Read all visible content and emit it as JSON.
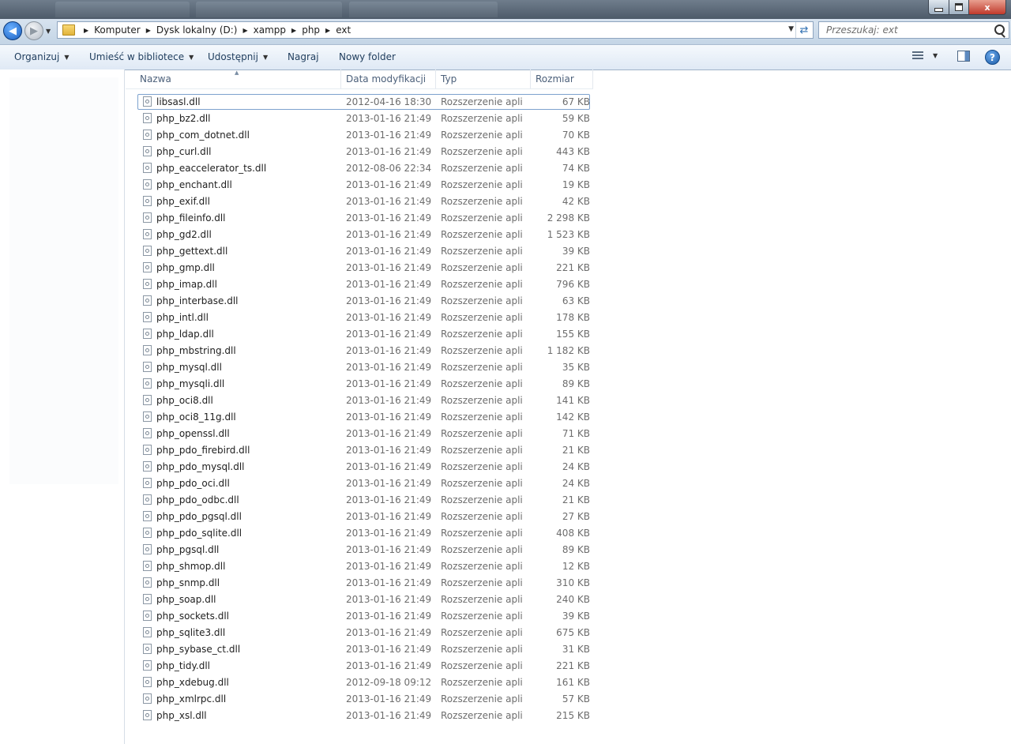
{
  "window": {
    "controls": {
      "minimize": "",
      "maximize": "",
      "close": "x"
    }
  },
  "address": {
    "breadcrumbs": [
      "Komputer",
      "Dysk lokalny (D:)",
      "xampp",
      "php",
      "ext"
    ],
    "search_placeholder": "Przeszukaj: ext"
  },
  "toolbar": {
    "organize": "Organizuj",
    "include_in_library": "Umieść w bibliotece",
    "share": "Udostępnij",
    "burn": "Nagraj",
    "new_folder": "Nowy folder"
  },
  "columns": {
    "name": "Nazwa",
    "date": "Data modyfikacji",
    "type": "Typ",
    "size": "Rozmiar"
  },
  "files": [
    {
      "name": "libsasl.dll",
      "date": "2012-04-16 18:30",
      "type": "Rozszerzenie aplik...",
      "size": "67 KB"
    },
    {
      "name": "php_bz2.dll",
      "date": "2013-01-16 21:49",
      "type": "Rozszerzenie aplik...",
      "size": "59 KB"
    },
    {
      "name": "php_com_dotnet.dll",
      "date": "2013-01-16 21:49",
      "type": "Rozszerzenie aplik...",
      "size": "70 KB"
    },
    {
      "name": "php_curl.dll",
      "date": "2013-01-16 21:49",
      "type": "Rozszerzenie aplik...",
      "size": "443 KB"
    },
    {
      "name": "php_eaccelerator_ts.dll",
      "date": "2012-08-06 22:34",
      "type": "Rozszerzenie aplik...",
      "size": "74 KB"
    },
    {
      "name": "php_enchant.dll",
      "date": "2013-01-16 21:49",
      "type": "Rozszerzenie aplik...",
      "size": "19 KB"
    },
    {
      "name": "php_exif.dll",
      "date": "2013-01-16 21:49",
      "type": "Rozszerzenie aplik...",
      "size": "42 KB"
    },
    {
      "name": "php_fileinfo.dll",
      "date": "2013-01-16 21:49",
      "type": "Rozszerzenie aplik...",
      "size": "2 298 KB"
    },
    {
      "name": "php_gd2.dll",
      "date": "2013-01-16 21:49",
      "type": "Rozszerzenie aplik...",
      "size": "1 523 KB"
    },
    {
      "name": "php_gettext.dll",
      "date": "2013-01-16 21:49",
      "type": "Rozszerzenie aplik...",
      "size": "39 KB"
    },
    {
      "name": "php_gmp.dll",
      "date": "2013-01-16 21:49",
      "type": "Rozszerzenie aplik...",
      "size": "221 KB"
    },
    {
      "name": "php_imap.dll",
      "date": "2013-01-16 21:49",
      "type": "Rozszerzenie aplik...",
      "size": "796 KB"
    },
    {
      "name": "php_interbase.dll",
      "date": "2013-01-16 21:49",
      "type": "Rozszerzenie aplik...",
      "size": "63 KB"
    },
    {
      "name": "php_intl.dll",
      "date": "2013-01-16 21:49",
      "type": "Rozszerzenie aplik...",
      "size": "178 KB"
    },
    {
      "name": "php_ldap.dll",
      "date": "2013-01-16 21:49",
      "type": "Rozszerzenie aplik...",
      "size": "155 KB"
    },
    {
      "name": "php_mbstring.dll",
      "date": "2013-01-16 21:49",
      "type": "Rozszerzenie aplik...",
      "size": "1 182 KB"
    },
    {
      "name": "php_mysql.dll",
      "date": "2013-01-16 21:49",
      "type": "Rozszerzenie aplik...",
      "size": "35 KB"
    },
    {
      "name": "php_mysqli.dll",
      "date": "2013-01-16 21:49",
      "type": "Rozszerzenie aplik...",
      "size": "89 KB"
    },
    {
      "name": "php_oci8.dll",
      "date": "2013-01-16 21:49",
      "type": "Rozszerzenie aplik...",
      "size": "141 KB"
    },
    {
      "name": "php_oci8_11g.dll",
      "date": "2013-01-16 21:49",
      "type": "Rozszerzenie aplik...",
      "size": "142 KB"
    },
    {
      "name": "php_openssl.dll",
      "date": "2013-01-16 21:49",
      "type": "Rozszerzenie aplik...",
      "size": "71 KB"
    },
    {
      "name": "php_pdo_firebird.dll",
      "date": "2013-01-16 21:49",
      "type": "Rozszerzenie aplik...",
      "size": "21 KB"
    },
    {
      "name": "php_pdo_mysql.dll",
      "date": "2013-01-16 21:49",
      "type": "Rozszerzenie aplik...",
      "size": "24 KB"
    },
    {
      "name": "php_pdo_oci.dll",
      "date": "2013-01-16 21:49",
      "type": "Rozszerzenie aplik...",
      "size": "24 KB"
    },
    {
      "name": "php_pdo_odbc.dll",
      "date": "2013-01-16 21:49",
      "type": "Rozszerzenie aplik...",
      "size": "21 KB"
    },
    {
      "name": "php_pdo_pgsql.dll",
      "date": "2013-01-16 21:49",
      "type": "Rozszerzenie aplik...",
      "size": "27 KB"
    },
    {
      "name": "php_pdo_sqlite.dll",
      "date": "2013-01-16 21:49",
      "type": "Rozszerzenie aplik...",
      "size": "408 KB"
    },
    {
      "name": "php_pgsql.dll",
      "date": "2013-01-16 21:49",
      "type": "Rozszerzenie aplik...",
      "size": "89 KB"
    },
    {
      "name": "php_shmop.dll",
      "date": "2013-01-16 21:49",
      "type": "Rozszerzenie aplik...",
      "size": "12 KB"
    },
    {
      "name": "php_snmp.dll",
      "date": "2013-01-16 21:49",
      "type": "Rozszerzenie aplik...",
      "size": "310 KB"
    },
    {
      "name": "php_soap.dll",
      "date": "2013-01-16 21:49",
      "type": "Rozszerzenie aplik...",
      "size": "240 KB"
    },
    {
      "name": "php_sockets.dll",
      "date": "2013-01-16 21:49",
      "type": "Rozszerzenie aplik...",
      "size": "39 KB"
    },
    {
      "name": "php_sqlite3.dll",
      "date": "2013-01-16 21:49",
      "type": "Rozszerzenie aplik...",
      "size": "675 KB"
    },
    {
      "name": "php_sybase_ct.dll",
      "date": "2013-01-16 21:49",
      "type": "Rozszerzenie aplik...",
      "size": "31 KB"
    },
    {
      "name": "php_tidy.dll",
      "date": "2013-01-16 21:49",
      "type": "Rozszerzenie aplik...",
      "size": "221 KB"
    },
    {
      "name": "php_xdebug.dll",
      "date": "2012-09-18 09:12",
      "type": "Rozszerzenie aplik...",
      "size": "161 KB"
    },
    {
      "name": "php_xmlrpc.dll",
      "date": "2013-01-16 21:49",
      "type": "Rozszerzenie aplik...",
      "size": "57 KB"
    },
    {
      "name": "php_xsl.dll",
      "date": "2013-01-16 21:49",
      "type": "Rozszerzenie aplik...",
      "size": "215 KB"
    }
  ],
  "selected_file": "libsasl.dll"
}
